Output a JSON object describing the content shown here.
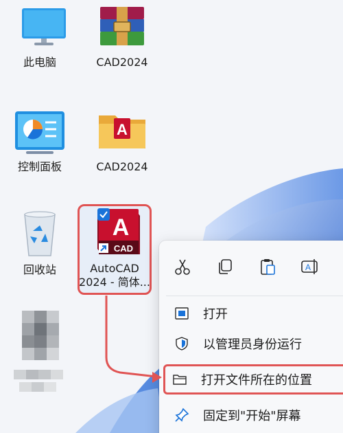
{
  "desktop": {
    "icons": [
      {
        "label": "此电脑",
        "icon": "monitor-icon"
      },
      {
        "label": "CAD2024",
        "icon": "winrar-archive-icon"
      },
      {
        "label": "控制面板",
        "icon": "control-panel-icon"
      },
      {
        "label": "CAD2024",
        "icon": "folder-autocad-icon"
      },
      {
        "label": "回收站",
        "icon": "recycle-bin-icon"
      }
    ],
    "selected_icon": {
      "label_line1": "AutoCAD",
      "label_line2": "2024 - 简体...",
      "badge_text": "CAD",
      "logo_letter": "A",
      "icon": "autocad-shortcut-icon"
    }
  },
  "context_menu": {
    "toolbar": [
      {
        "icon": "cut-icon"
      },
      {
        "icon": "copy-icon"
      },
      {
        "icon": "paste-icon"
      },
      {
        "icon": "rename-icon"
      }
    ],
    "items": [
      {
        "label": "打开",
        "icon": "app-window-icon"
      },
      {
        "label": "以管理员身份运行",
        "icon": "shield-icon"
      },
      {
        "label": "打开文件所在的位置",
        "icon": "folder-icon",
        "highlighted": true
      },
      {
        "label": "固定到\"开始\"屏幕",
        "icon": "pin-icon"
      }
    ]
  },
  "colors": {
    "annotation_red": "#e05454",
    "autocad_red": "#c8102e",
    "selection_blue": "#1a73d9",
    "wallpaper_blue": "#2f6fd6"
  }
}
